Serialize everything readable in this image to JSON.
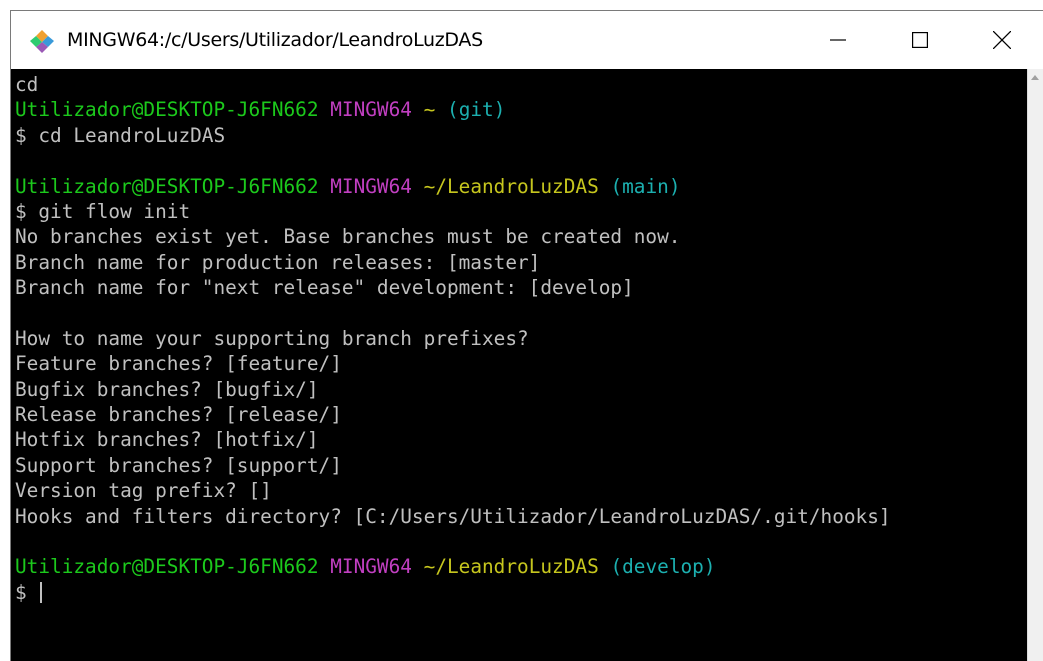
{
  "window": {
    "title": "MINGW64:/c/Users/Utilizador/LeandroLuzDAS",
    "app_icon": "git-diamond-icon",
    "controls": {
      "minimize_icon": "minimize-icon",
      "maximize_icon": "maximize-icon",
      "close_icon": "close-icon"
    }
  },
  "colors": {
    "background": "#000000",
    "text": "#c0c0c0",
    "user_host": "#1cc91c",
    "system": "#c13fc1",
    "path": "#c6c61e",
    "branch": "#1cb0b0"
  },
  "terminal": {
    "lines": [
      {
        "type": "text",
        "text": "cd"
      },
      {
        "type": "prompt",
        "user": "Utilizador@DESKTOP-J6FN662",
        "system": "MINGW64",
        "path": "~",
        "branch": "(git)"
      },
      {
        "type": "text",
        "text": "$ cd LeandroLuzDAS"
      },
      {
        "type": "blank"
      },
      {
        "type": "prompt",
        "user": "Utilizador@DESKTOP-J6FN662",
        "system": "MINGW64",
        "path": "~/LeandroLuzDAS",
        "branch": "(main)"
      },
      {
        "type": "text",
        "text": "$ git flow init"
      },
      {
        "type": "text",
        "text": "No branches exist yet. Base branches must be created now."
      },
      {
        "type": "text",
        "text": "Branch name for production releases: [master]"
      },
      {
        "type": "text",
        "text": "Branch name for \"next release\" development: [develop]"
      },
      {
        "type": "blank"
      },
      {
        "type": "text",
        "text": "How to name your supporting branch prefixes?"
      },
      {
        "type": "text",
        "text": "Feature branches? [feature/]"
      },
      {
        "type": "text",
        "text": "Bugfix branches? [bugfix/]"
      },
      {
        "type": "text",
        "text": "Release branches? [release/]"
      },
      {
        "type": "text",
        "text": "Hotfix branches? [hotfix/]"
      },
      {
        "type": "text",
        "text": "Support branches? [support/]"
      },
      {
        "type": "text",
        "text": "Version tag prefix? []"
      },
      {
        "type": "text",
        "text": "Hooks and filters directory? [C:/Users/Utilizador/LeandroLuzDAS/.git/hooks]"
      },
      {
        "type": "blank"
      },
      {
        "type": "prompt",
        "user": "Utilizador@DESKTOP-J6FN662",
        "system": "MINGW64",
        "path": "~/LeandroLuzDAS",
        "branch": "(develop)"
      },
      {
        "type": "input",
        "text": "$ "
      }
    ]
  }
}
